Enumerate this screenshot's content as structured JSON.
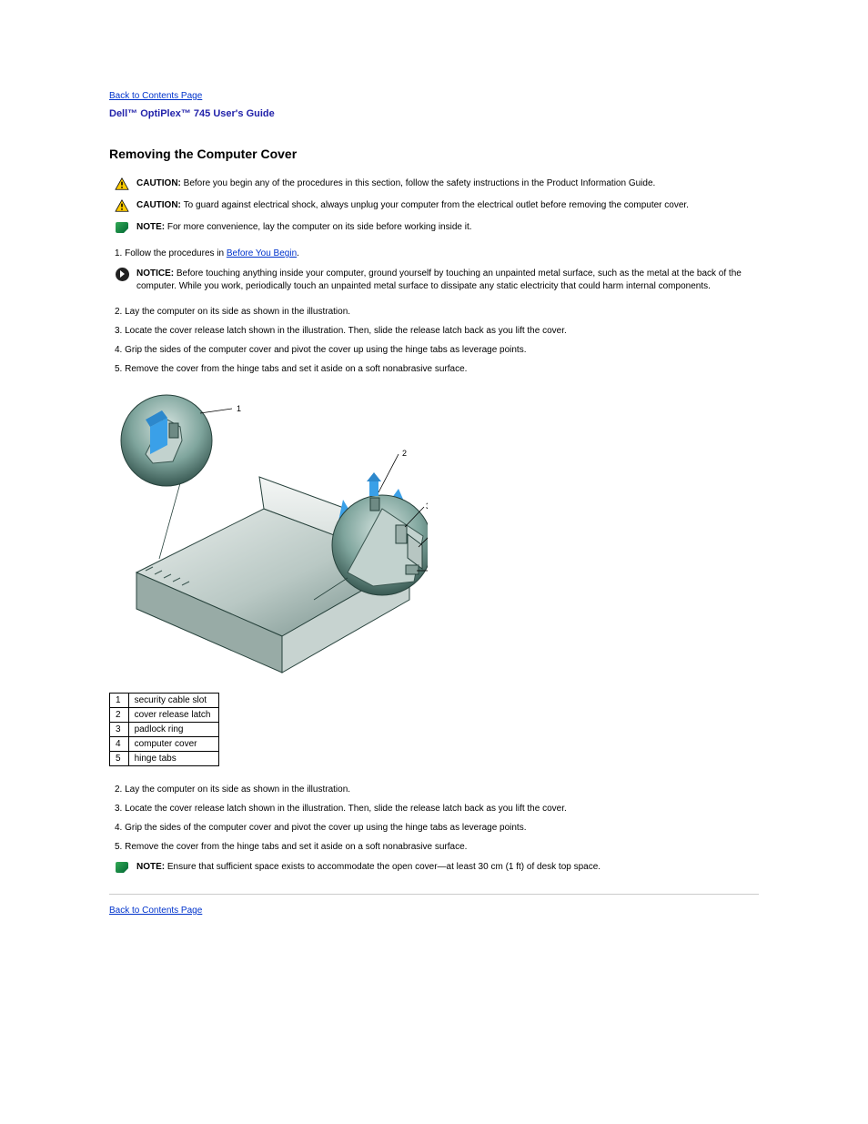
{
  "nav": {
    "back_top": "Back to Contents Page",
    "back_bottom": "Back to Contents Page"
  },
  "doc_title": "Dell™ OptiPlex™ 745 User's Guide",
  "section_title": "Removing the Computer Cover",
  "steps": {
    "s1": "1. Follow the procedures in ",
    "s1_link": "Before You Begin",
    "s1_after": ".",
    "s2": "2. Lay the computer on its side as shown in the illustration.",
    "s3": "3. Locate the cover release latch shown in the illustration. Then, slide the release latch back as you lift the cover.",
    "s4": "4. Grip the sides of the computer cover and pivot the cover up using the hinge tabs as leverage points.",
    "s5": "5. Remove the cover from the hinge tabs and set it aside on a soft nonabrasive surface."
  },
  "callouts": {
    "caution1_label": "CAUTION: ",
    "caution1_text": "Before you begin any of the procedures in this section, follow the safety instructions in the Product Information Guide.",
    "caution2_label": "CAUTION: ",
    "caution2_text": "To guard against electrical shock, always unplug your computer from the electrical outlet before removing the computer cover.",
    "note1_label": "NOTE: ",
    "note1_text": "For more convenience, lay the computer on its side before working inside it.",
    "notice1_label": "NOTICE: ",
    "notice1_text": "Before touching anything inside your computer, ground yourself by touching an unpainted metal surface, such as the metal at the back of the computer. While you work, periodically touch an unpainted metal surface to dissipate any static electricity that could harm internal components.",
    "note2_label": "NOTE: ",
    "note2_text": "Ensure that sufficient space exists to accommodate the open cover—at least 30 cm (1 ft) of desk top space."
  },
  "parts": [
    {
      "n": "1",
      "label": "security cable slot"
    },
    {
      "n": "2",
      "label": "cover release latch"
    },
    {
      "n": "3",
      "label": "padlock ring"
    },
    {
      "n": "4",
      "label": "computer cover"
    },
    {
      "n": "5",
      "label": "hinge tabs"
    }
  ]
}
